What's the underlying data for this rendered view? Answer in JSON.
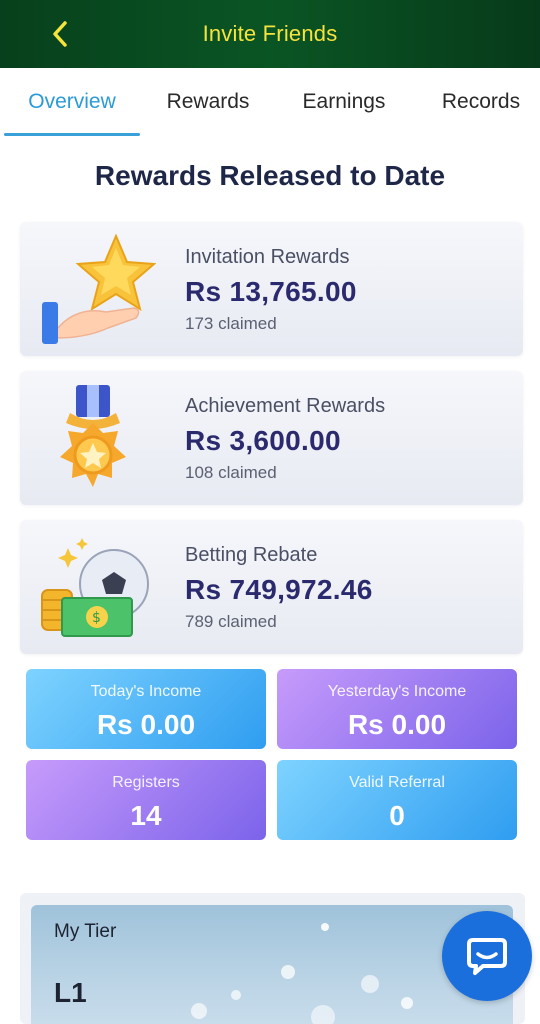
{
  "header": {
    "title": "Invite Friends",
    "back_icon": "chevron-left-icon"
  },
  "tabs": [
    {
      "label": "Overview",
      "active": true
    },
    {
      "label": "Rewards",
      "active": false
    },
    {
      "label": "Earnings",
      "active": false
    },
    {
      "label": "Records",
      "active": false
    }
  ],
  "section_title": "Rewards Released to Date",
  "reward_cards": [
    {
      "label": "Invitation Rewards",
      "amount": "Rs 13,765.00",
      "claimed": "173 claimed",
      "icon": "star-hand-icon"
    },
    {
      "label": "Achievement Rewards",
      "amount": "Rs 3,600.00",
      "claimed": "108 claimed",
      "icon": "medal-icon"
    },
    {
      "label": "Betting Rebate",
      "amount": "Rs 749,972.46",
      "claimed": "789 claimed",
      "icon": "coins-ball-icon"
    }
  ],
  "stats": [
    {
      "label": "Today's Income",
      "value": "Rs 0.00"
    },
    {
      "label": "Yesterday's Income",
      "value": "Rs 0.00"
    },
    {
      "label": "Registers",
      "value": "14"
    },
    {
      "label": "Valid Referral",
      "value": "0"
    }
  ],
  "tier": {
    "label": "My Tier",
    "level": "L1"
  },
  "colors": {
    "header_bg": "#07401c",
    "header_title": "#f6e33c",
    "active_tab": "#2a9bd6",
    "chat_button": "#1a6fdc"
  },
  "chat_icon": "chat-bubble-icon"
}
